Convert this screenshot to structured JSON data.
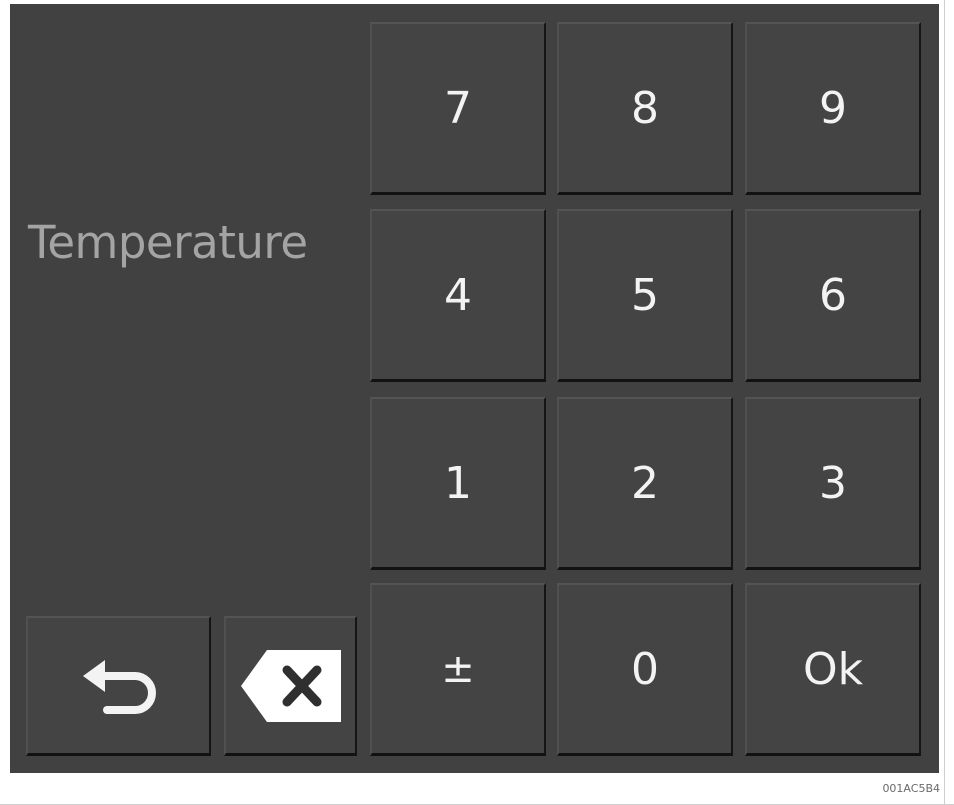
{
  "keypad": {
    "field_label": "Temperature",
    "keys": {
      "k7": "7",
      "k8": "8",
      "k9": "9",
      "k4": "4",
      "k5": "5",
      "k6": "6",
      "k1": "1",
      "k2": "2",
      "k3": "3",
      "plus_minus": "±",
      "k0": "0",
      "ok": "Ok"
    },
    "icons": {
      "back": "return-arrow-icon",
      "delete": "backspace-icon"
    }
  },
  "footer": {
    "code": "001AC5B4"
  },
  "colors": {
    "panel_background": "#414141",
    "key_face": "#444444",
    "key_text": "#f3f3f3",
    "label_text": "#a4a4a4"
  }
}
